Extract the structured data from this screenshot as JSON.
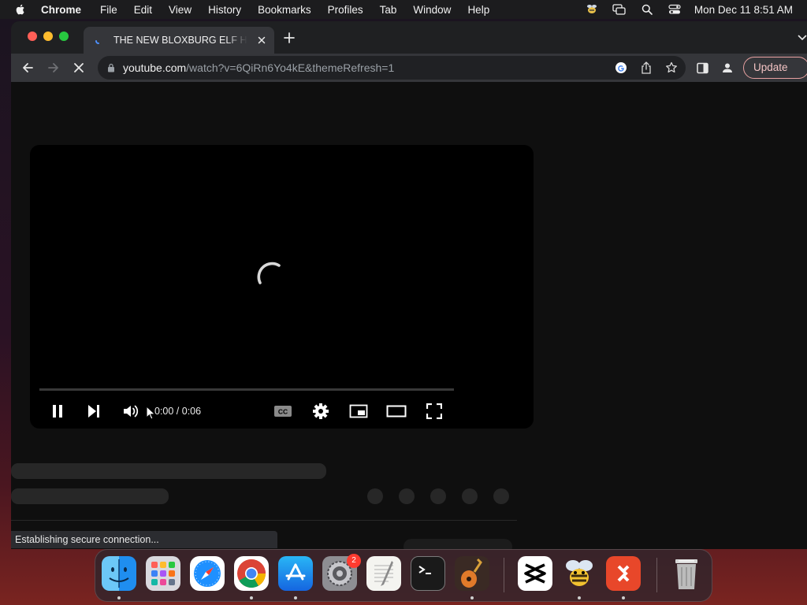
{
  "menubar": {
    "app_name": "Chrome",
    "items": [
      "File",
      "Edit",
      "View",
      "History",
      "Bookmarks",
      "Profiles",
      "Tab",
      "Window",
      "Help"
    ],
    "status_icons": [
      "bee-status-icon",
      "screen-mirroring-icon",
      "spotlight-search-icon",
      "control-center-icon"
    ],
    "clock": "Mon Dec 11  8:51 AM"
  },
  "tab": {
    "title": "THE NEW BLOXBURG ELF HUNT"
  },
  "omnibox": {
    "url_host": "youtube.com",
    "url_rest": "/watch?v=6QiRn6Yo4kE&themeRefresh=1"
  },
  "toolbar": {
    "update_label": "Update"
  },
  "player": {
    "time": "0:00 / 0:06",
    "progress": 0.0
  },
  "status_bubble": "Establishing secure connection...",
  "dock": {
    "apps": [
      "finder",
      "launchpad",
      "safari",
      "chrome",
      "app-store",
      "system-settings",
      "textedit",
      "terminal",
      "garageband",
      "capcut",
      "bee-app",
      "remote-desktop",
      "trash"
    ],
    "settings_badge": "2"
  },
  "colors": {
    "accent_red": "#ff0000",
    "update_border": "#e8a1a1",
    "background": "#0f0f0f"
  }
}
